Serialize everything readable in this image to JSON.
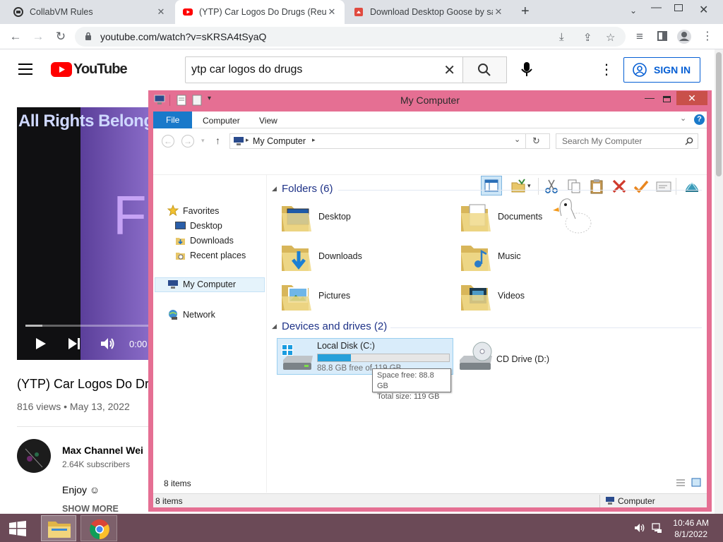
{
  "browser": {
    "tabs": [
      {
        "title": "CollabVM Rules",
        "active": false
      },
      {
        "title": "(YTP) Car Logos Do Drugs (Reupl",
        "active": true
      },
      {
        "title": "Download Desktop Goose by sam",
        "active": false
      }
    ],
    "url": "youtube.com/watch?v=sKRSA4tSyaQ"
  },
  "youtube": {
    "logo_text": "YouTube",
    "search_query": "ytp car logos do drugs",
    "sign_in_label": "SIGN IN",
    "video_overlay_text": "All Rights Belong",
    "video_big_text": "Fu",
    "time_display": "0:00",
    "video_title": "(YTP) Car Logos Do Dru",
    "video_stats": "816 views • May 13, 2022",
    "channel_name": "Max Channel Wei",
    "subscribers": "2.64K subscribers",
    "description": "Enjoy ☺",
    "show_more_label": "SHOW MORE"
  },
  "explorer": {
    "window_title": "My Computer",
    "ribbon_tabs": {
      "file": "File",
      "computer": "Computer",
      "view": "View"
    },
    "address_path": "My Computer",
    "search_placeholder": "Search My Computer",
    "nav": {
      "favorites": "Favorites",
      "desktop": "Desktop",
      "downloads": "Downloads",
      "recent": "Recent places",
      "my_computer": "My Computer",
      "network": "Network"
    },
    "folders_header": "Folders (6)",
    "folders": [
      {
        "name": "Desktop"
      },
      {
        "name": "Documents"
      },
      {
        "name": "Downloads"
      },
      {
        "name": "Music"
      },
      {
        "name": "Pictures"
      },
      {
        "name": "Videos"
      }
    ],
    "devices_header": "Devices and drives (2)",
    "drives": [
      {
        "name": "Local Disk (C:)",
        "free_text": "88.8 GB free of 119 GB",
        "used_fraction": 0.254
      },
      {
        "name": "CD Drive (D:)"
      }
    ],
    "tooltip": {
      "line1": "Space free: 88.8 GB",
      "line2": "Total size: 119 GB"
    },
    "status_items": "8 items",
    "statusbar_items": "8 items",
    "statusbar_location": "Computer"
  },
  "taskbar": {
    "time": "10:46 AM",
    "date": "8/1/2022"
  }
}
